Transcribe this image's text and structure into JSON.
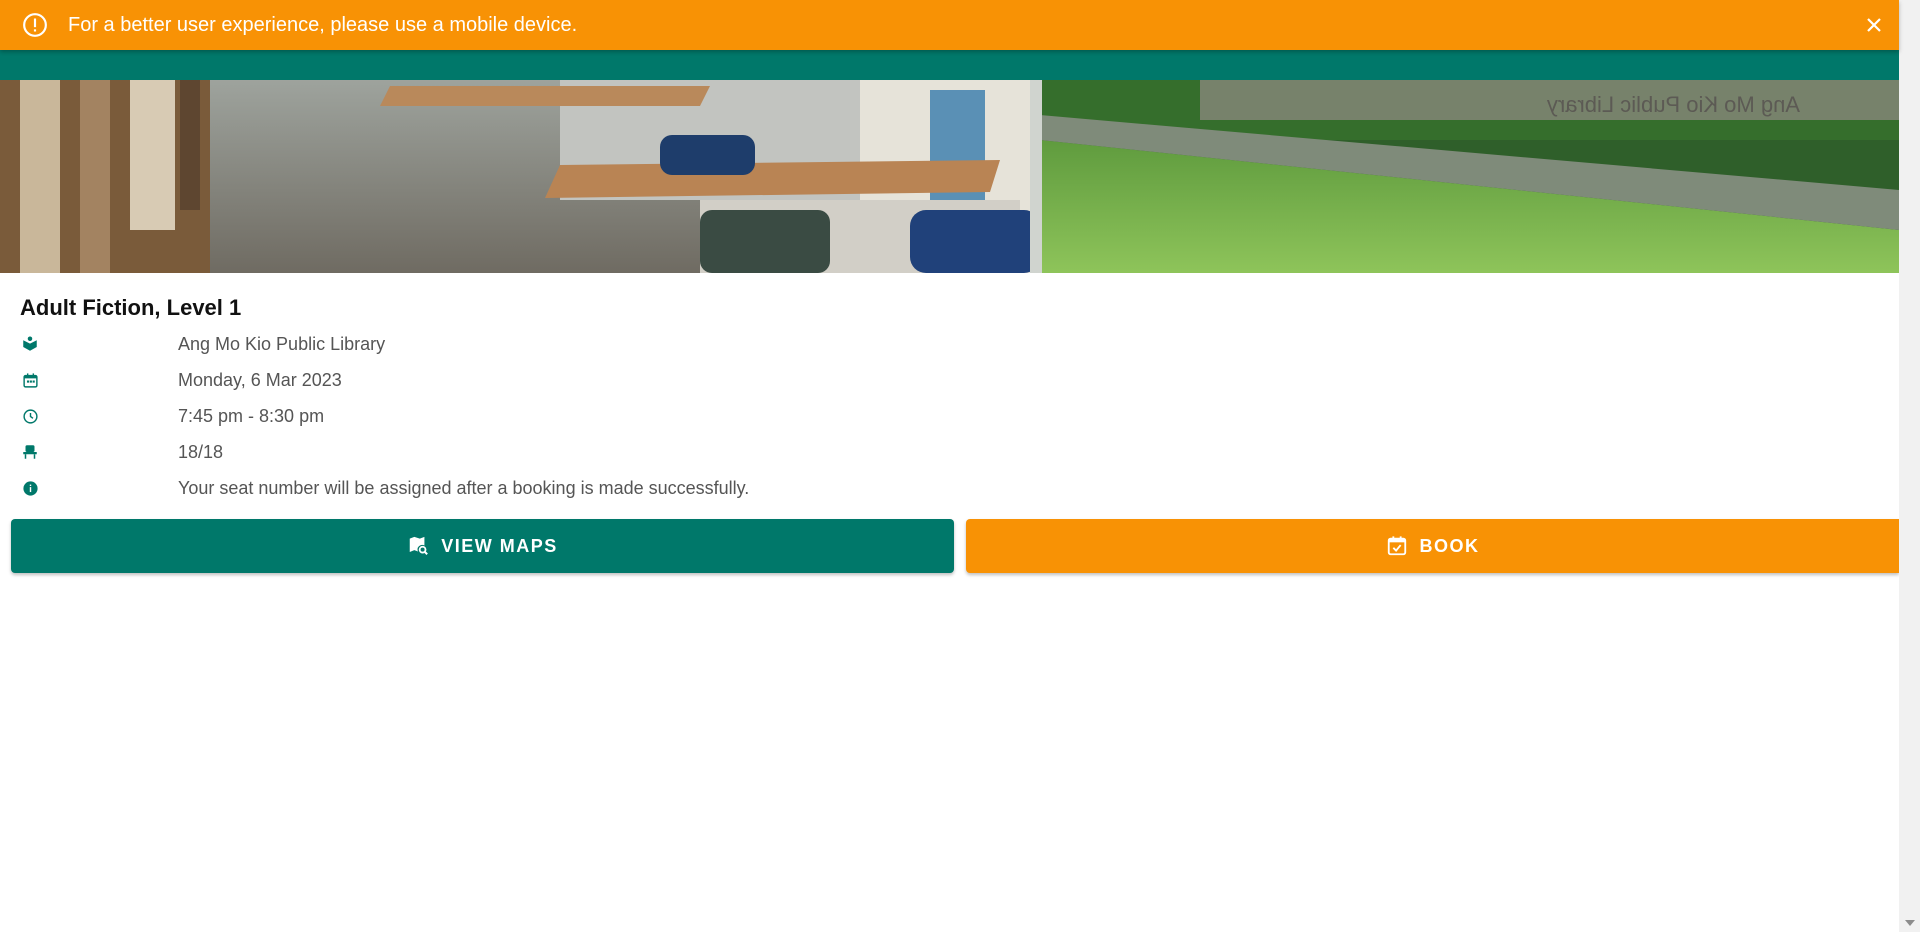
{
  "banner": {
    "message": "For a better user experience, please use a mobile device.",
    "icon": "alert-circle-icon",
    "close_icon": "close-icon",
    "background": "#f89205"
  },
  "header": {
    "background": "#00786a"
  },
  "hero": {
    "sign_text": "Ang Mo Kio Public Library"
  },
  "area": {
    "title": "Adult Fiction, Level 1",
    "details": [
      {
        "icon": "library-book-icon",
        "value": "Ang Mo Kio Public Library"
      },
      {
        "icon": "calendar-icon",
        "value": "Monday, 6 Mar 2023"
      },
      {
        "icon": "clock-icon",
        "value": "7:45 pm - 8:30 pm"
      },
      {
        "icon": "seat-icon",
        "value": "18/18"
      },
      {
        "icon": "info-icon",
        "value": "Your seat number will be assigned after a booking is made successfully."
      }
    ]
  },
  "actions": {
    "view_maps": {
      "label": "VIEW MAPS",
      "icon": "map-search-icon",
      "color": "#00786a"
    },
    "book": {
      "label": "BOOK",
      "icon": "calendar-check-icon",
      "color": "#f89205"
    }
  }
}
